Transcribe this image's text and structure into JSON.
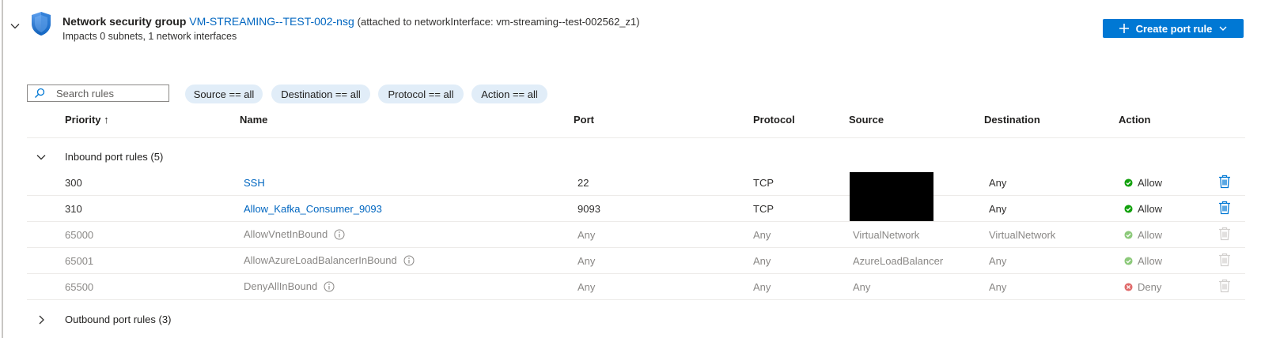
{
  "nsg": {
    "title_prefix": "Network security group",
    "name": "VM-STREAMING--TEST-002-nsg",
    "attached_prefix": "(attached to networkInterface: ",
    "interface": "vm-streaming--test-002562_z1",
    "attached_suffix": ")",
    "impacts": "Impacts 0 subnets, 1 network interfaces"
  },
  "toolbar": {
    "create_label": "Create port rule"
  },
  "search": {
    "placeholder": "Search rules",
    "value": ""
  },
  "filters": [
    "Source == all",
    "Destination == all",
    "Protocol == all",
    "Action == all"
  ],
  "columns": {
    "priority": "Priority",
    "sort_indicator": "↑",
    "name": "Name",
    "port": "Port",
    "protocol": "Protocol",
    "source": "Source",
    "destination": "Destination",
    "action": "Action"
  },
  "inbound": {
    "label": "Inbound port rules (5)",
    "rows": [
      {
        "priority": "300",
        "name": "SSH",
        "port": "22",
        "protocol": "TCP",
        "source": "",
        "destination": "Any",
        "action": "Allow"
      },
      {
        "priority": "310",
        "name": "Allow_Kafka_Consumer_9093",
        "port": "9093",
        "protocol": "TCP",
        "source": "",
        "destination": "Any",
        "action": "Allow"
      },
      {
        "priority": "65000",
        "name": "AllowVnetInBound",
        "port": "Any",
        "protocol": "Any",
        "source": "VirtualNetwork",
        "destination": "VirtualNetwork",
        "action": "Allow"
      },
      {
        "priority": "65001",
        "name": "AllowAzureLoadBalancerInBound",
        "port": "Any",
        "protocol": "Any",
        "source": "AzureLoadBalancer",
        "destination": "Any",
        "action": "Allow"
      },
      {
        "priority": "65500",
        "name": "DenyAllInBound",
        "port": "Any",
        "protocol": "Any",
        "source": "Any",
        "destination": "Any",
        "action": "Deny"
      }
    ]
  },
  "outbound": {
    "label": "Outbound port rules (3)"
  },
  "colors": {
    "accent": "#0078d4",
    "link": "#0066c0",
    "allow": "#13a10e",
    "allow_muted": "#8cc97a",
    "deny": "#e06b6b",
    "pill_bg": "#e1edf8"
  }
}
